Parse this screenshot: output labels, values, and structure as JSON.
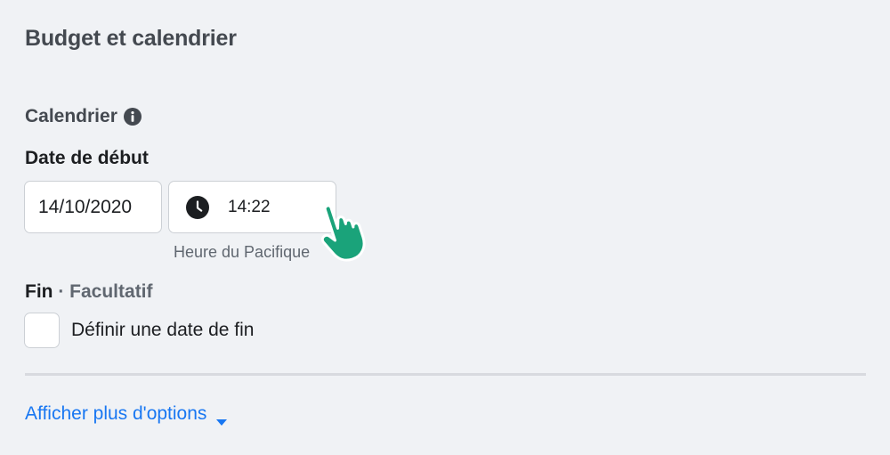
{
  "section": {
    "title": "Budget et calendrier"
  },
  "schedule": {
    "label": "Calendrier",
    "info_icon": "info-icon"
  },
  "start": {
    "label": "Date de début",
    "date_value": "14/10/2020",
    "time_value": "14:22",
    "clock_icon": "clock-icon",
    "timezone": "Heure du Pacifique"
  },
  "end": {
    "label": "Fin",
    "separator": " · ",
    "optional": "Facultatif",
    "checkbox_label": "Définir une date de fin",
    "checked": false
  },
  "more_options": {
    "label": "Afficher plus d'options",
    "icon": "caret-down-icon"
  },
  "cursor": {
    "icon": "pointer-hand-icon",
    "color": "#1aa37a"
  },
  "colors": {
    "link": "#1877f2",
    "background": "#f0f2f5",
    "border": "#ccd0d5",
    "divider": "#d8dadf"
  }
}
